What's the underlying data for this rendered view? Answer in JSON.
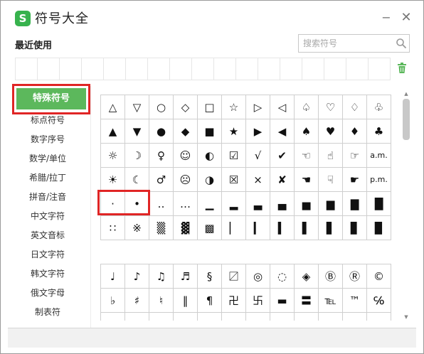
{
  "window": {
    "logo": "S",
    "title": "符号大全",
    "minimize": "−",
    "close": "✕"
  },
  "recent": {
    "label": "最近使用",
    "slots": 17
  },
  "search": {
    "placeholder": "搜索符号",
    "value": ""
  },
  "sidebar": {
    "active": "特殊符号",
    "items": [
      "标点符号",
      "数字序号",
      "数学/单位",
      "希腊/拉丁",
      "拼音/注音",
      "中文字符",
      "英文音标",
      "日文字符",
      "韩文字符",
      "俄文字母",
      "制表符"
    ]
  },
  "grid1": [
    [
      "△",
      "▽",
      "○",
      "◇",
      "□",
      "☆",
      "▷",
      "◁",
      "♤",
      "♡",
      "♢",
      "♧"
    ],
    [
      "▲",
      "▼",
      "●",
      "◆",
      "■",
      "★",
      "▶",
      "◀",
      "♠",
      "♥",
      "♦",
      "♣"
    ],
    [
      "☼",
      "☽",
      "♀",
      "☺",
      "◐",
      "☑",
      "√",
      "✔",
      "☜",
      "☝",
      "☞",
      "a.m."
    ],
    [
      "☀",
      "☾",
      "♂",
      "☹",
      "◑",
      "☒",
      "×",
      "✘",
      "☚",
      "☟",
      "☛",
      "p.m."
    ],
    [
      "·",
      "•",
      "‥",
      "…",
      "▁",
      "▂",
      "▃",
      "▄",
      "▅",
      "▆",
      "▇",
      "█"
    ],
    [
      "∷",
      "※",
      "▒",
      "▓",
      "▩",
      "▏",
      "▎",
      "▍",
      "▌",
      "▋",
      "▊",
      "▉"
    ]
  ],
  "grid2": [
    [
      "♩",
      "♪",
      "♫",
      "♬",
      "§",
      "〼",
      "◎",
      "◌",
      "◈",
      "Ⓑ",
      "Ⓡ",
      "©"
    ],
    [
      "♭",
      "♯",
      "♮",
      "‖",
      "¶",
      "卍",
      "卐",
      "▬",
      "〓",
      "℡",
      "™",
      "℅"
    ],
    [
      "",
      "",
      "",
      "",
      "",
      "",
      "",
      "",
      "",
      "",
      "",
      ""
    ]
  ],
  "colors": {
    "accent_green": "#5cb85c",
    "highlight_red": "#e02525",
    "logo_green": "#37b24d"
  }
}
